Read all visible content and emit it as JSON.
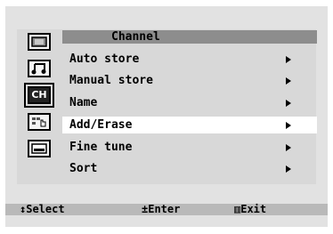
{
  "menu": {
    "title": "Channel",
    "items": [
      {
        "label": "Auto store",
        "selected": false
      },
      {
        "label": "Manual store",
        "selected": false
      },
      {
        "label": "Name",
        "selected": false
      },
      {
        "label": "Add/Erase",
        "selected": true
      },
      {
        "label": "Fine tune",
        "selected": false
      },
      {
        "label": "Sort",
        "selected": false
      }
    ]
  },
  "sidebar": {
    "icons": [
      {
        "name": "tv-picture-icon",
        "selected": false
      },
      {
        "name": "sound-icon",
        "selected": false
      },
      {
        "name": "channel-icon",
        "label": "CH",
        "selected": true
      },
      {
        "name": "setup-icon",
        "selected": false
      },
      {
        "name": "input-icon",
        "selected": false
      }
    ]
  },
  "footer": {
    "select_glyph": "↕",
    "select_label": "Select",
    "enter_glyph": "±",
    "enter_label": "Enter",
    "exit_glyph": "▥",
    "exit_label": "Exit"
  }
}
